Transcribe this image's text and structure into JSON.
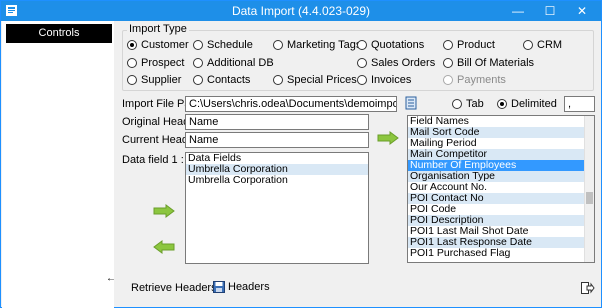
{
  "window": {
    "title": "Data Import (4.4.023-029)",
    "minimize_glyph": "—",
    "maximize_glyph": "☐",
    "close_glyph": "✕"
  },
  "sidebar": {
    "controls_label": "Controls",
    "back_glyph": "←"
  },
  "import_type": {
    "label": "Import Type",
    "options": [
      {
        "label": "Customer",
        "selected": true,
        "disabled": false
      },
      {
        "label": "Schedule",
        "selected": false,
        "disabled": false
      },
      {
        "label": "Marketing Tags",
        "selected": false,
        "disabled": false
      },
      {
        "label": "Quotations",
        "selected": false,
        "disabled": false
      },
      {
        "label": "Product",
        "selected": false,
        "disabled": false
      },
      {
        "label": "CRM",
        "selected": false,
        "disabled": false
      },
      {
        "label": "Prospect",
        "selected": false,
        "disabled": false
      },
      {
        "label": "Additional DB",
        "selected": false,
        "disabled": false
      },
      {
        "label": "Sales Orders",
        "selected": false,
        "disabled": false
      },
      {
        "label": "Bill Of Materials",
        "selected": false,
        "disabled": false
      },
      {
        "label": "Supplier",
        "selected": false,
        "disabled": false
      },
      {
        "label": "Contacts",
        "selected": false,
        "disabled": false
      },
      {
        "label": "Special Prices",
        "selected": false,
        "disabled": false
      },
      {
        "label": "Invoices",
        "selected": false,
        "disabled": false
      },
      {
        "label": "Payments",
        "selected": false,
        "disabled": true
      }
    ]
  },
  "file": {
    "path_label": "Import File Path:",
    "path_value": "C:\\Users\\chris.odea\\Documents\\demoimport.csv",
    "tab_label": "Tab",
    "delimited_label": "Delimited",
    "delimiter_value": ","
  },
  "headers": {
    "original_label": "Original Header:",
    "original_value": "Name",
    "current_label": "Current Header:",
    "current_value": "Name"
  },
  "data_field": {
    "label": "Data field 1 :",
    "items": [
      "Data Fields",
      "Umbrella Corporation",
      "Umbrella Corporation"
    ]
  },
  "field_names": {
    "items": [
      "Field Names",
      "Mail Sort Code",
      "Mailing Period",
      "Main Competitor",
      "Number Of Employees",
      "Organisation Type",
      "Our Account No.",
      "POI Contact No",
      "POI Code",
      "POI Description",
      "POI1 Last Mail Shot Date",
      "POI1 Last Response Date",
      "POI1 Purchased Flag"
    ],
    "selected_index": 4
  },
  "bottom": {
    "retrieve_label": "Retrieve Headers",
    "headers_label": "Headers"
  },
  "colors": {
    "title_bar": "#1e8fe8",
    "selection": "#3399ff",
    "arrow_green": "#8cc63f"
  }
}
